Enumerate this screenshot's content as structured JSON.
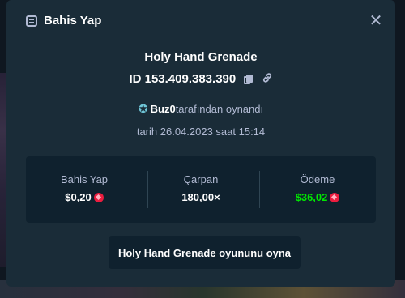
{
  "header": {
    "title": "Bahis Yap",
    "close_icon": "close-icon"
  },
  "game": {
    "title": "Holy Hand Grenade"
  },
  "bet": {
    "id": "ID 153.409.383.390"
  },
  "player": {
    "name": "Buz0",
    "suffix": "tarafından oynandı"
  },
  "date": {
    "text": "tarih 26.04.2023 saat 15:14"
  },
  "stats": {
    "bet": {
      "label": "Bahis Yap",
      "value": "$0,20"
    },
    "multiplier": {
      "label": "Çarpan",
      "value": "180,00×"
    },
    "payout": {
      "label": "Ödeme",
      "value": "$36,02"
    }
  },
  "action": {
    "play_label": "Holy Hand Grenade oyununu oyna"
  },
  "colors": {
    "modal_bg": "#1a2c38",
    "panel_bg": "#0f212e",
    "payout_green": "#00e701",
    "currency_red": "#ec1d3f"
  }
}
